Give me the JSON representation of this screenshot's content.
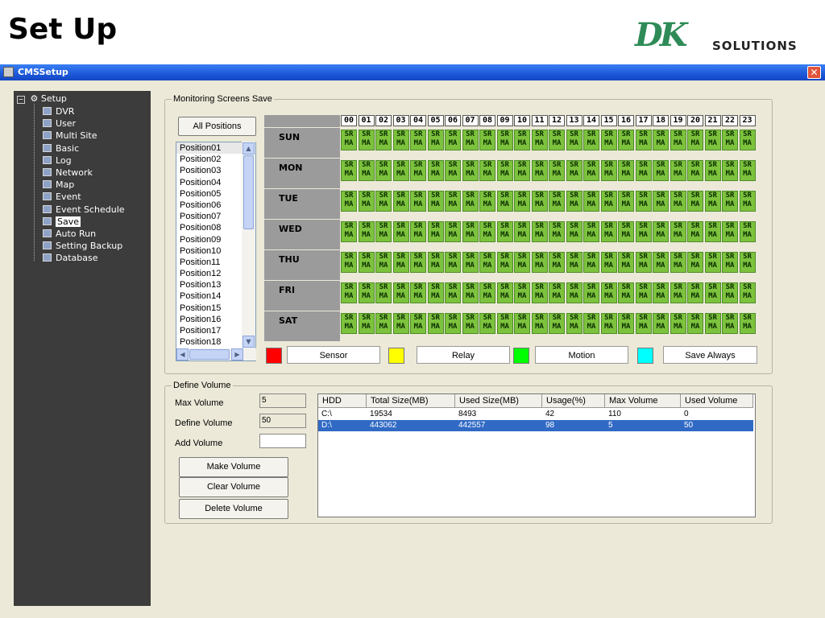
{
  "slide": {
    "title": "Set Up",
    "logo_main": "DK",
    "logo_sub": "SOLUTIONS"
  },
  "window": {
    "title": "CMSSetup",
    "close_glyph": "✕"
  },
  "tree": {
    "root": "Setup",
    "items": [
      "DVR",
      "User",
      "Multi Site",
      "Basic",
      "Log",
      "Network",
      "Map",
      "Event",
      "Event Schedule",
      "Save",
      "Auto Run",
      "Setting Backup",
      "Database"
    ],
    "selected_index": 9
  },
  "monitoring": {
    "group_label": "Monitoring Screens Save",
    "all_positions_label": "All Positions",
    "positions": [
      "Position01",
      "Position02",
      "Position03",
      "Position04",
      "Position05",
      "Position06",
      "Position07",
      "Position08",
      "Position09",
      "Position10",
      "Position11",
      "Position12",
      "Position13",
      "Position14",
      "Position15",
      "Position16",
      "Position17",
      "Position18"
    ],
    "selected_position": 0,
    "days": [
      "SUN",
      "MON",
      "TUE",
      "WED",
      "THU",
      "FRI",
      "SAT"
    ],
    "hours": [
      "00",
      "01",
      "02",
      "03",
      "04",
      "05",
      "06",
      "07",
      "08",
      "09",
      "10",
      "11",
      "12",
      "13",
      "14",
      "15",
      "16",
      "17",
      "18",
      "19",
      "20",
      "21",
      "22",
      "23"
    ],
    "cell_top": "SR",
    "cell_bottom": "MA",
    "legend": [
      {
        "label": "Sensor",
        "color": "#ff0000"
      },
      {
        "label": "Relay",
        "color": "#ffff00"
      },
      {
        "label": "Motion",
        "color": "#00ff00"
      },
      {
        "label": "Save Always",
        "color": "#00ffff"
      }
    ],
    "cell_color": "#7dc23d"
  },
  "volume": {
    "group_label": "Define Volume",
    "max_volume_label": "Max Volume",
    "max_volume_value": "5",
    "define_volume_label": "Define Volume",
    "define_volume_value": "50",
    "add_volume_label": "Add Volume",
    "add_volume_value": "",
    "make_volume_label": "Make Volume",
    "clear_volume_label": "Clear Volume",
    "delete_volume_label": "Delete Volume",
    "columns": [
      "HDD",
      "Total Size(MB)",
      "Used Size(MB)",
      "Usage(%)",
      "Max Volume",
      "Used Volume"
    ],
    "rows": [
      [
        "C:\\",
        "19534",
        "8493",
        "42",
        "110",
        "0"
      ],
      [
        "D:\\",
        "443062",
        "442557",
        "98",
        "5",
        "50"
      ]
    ],
    "selected_row": 1
  }
}
